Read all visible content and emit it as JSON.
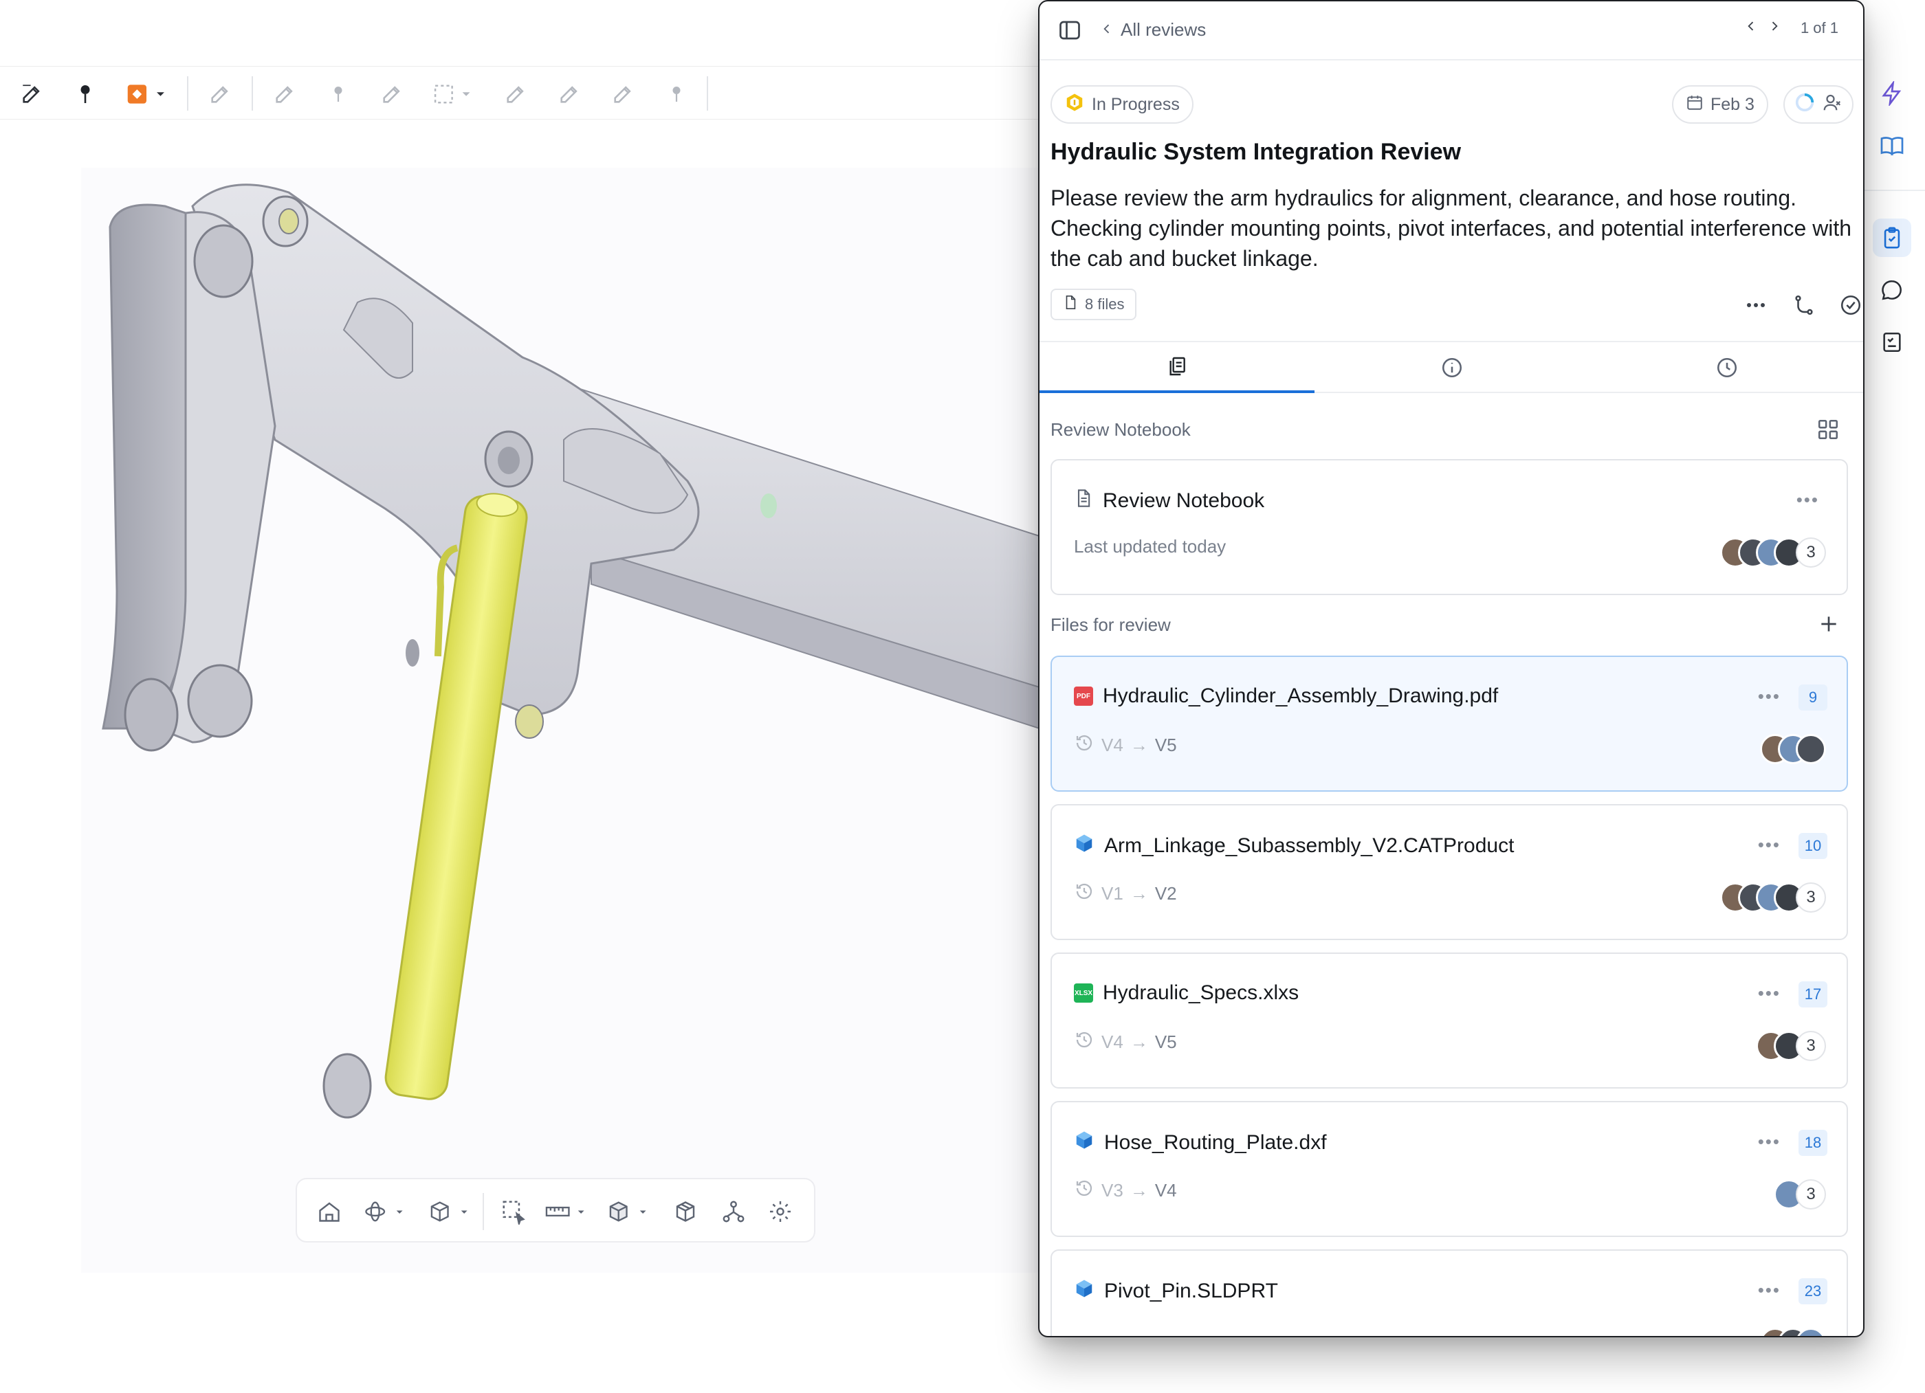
{
  "toolbar": {
    "tools": [
      "pencil-icon",
      "pin-icon",
      "shape-fill-icon",
      "pencil-icon",
      "pencil-icon",
      "pin-icon",
      "pencil-icon",
      "selection-icon",
      "pencil-icon",
      "pencil-icon",
      "pencil-icon",
      "pin-icon"
    ]
  },
  "viewbar": {
    "tools": [
      "home-icon",
      "orbit-icon",
      "cube-icon",
      "box-select-icon",
      "measure-icon",
      "section-cube-icon",
      "explode-icon",
      "tree-icon",
      "settings-icon"
    ]
  },
  "rail": {
    "items": [
      "lightning-icon",
      "book-icon",
      "review-clipboard-icon",
      "comment-icon",
      "checklist-icon"
    ],
    "active": "review-clipboard-icon"
  },
  "panel": {
    "back_label": "All reviews",
    "pager": "1 of 1",
    "status": "In Progress",
    "due_date": "Feb 3",
    "title": "Hydraulic System Integration Review",
    "description": "Please review the arm hydraulics for alignment, clearance, and hose routing. Checking cylinder mounting points, pivot interfaces, and potential interference with the cab and bucket linkage.",
    "files_chip": "8 files",
    "tabs": [
      "files-tab",
      "info-tab",
      "history-tab"
    ],
    "notebook_section": "Review Notebook",
    "notebook": {
      "title": "Review Notebook",
      "updated": "Last updated today",
      "reviewers": "3"
    },
    "files_section": "Files for review",
    "files": [
      {
        "name": "Hydraulic_Cylinder_Assembly_Drawing.pdf",
        "type": "PDF",
        "from": "V4",
        "to": "V5",
        "count": "9",
        "reviewers": ""
      },
      {
        "name": "Arm_Linkage_Subassembly_V2.CATProduct",
        "type": "CAD",
        "from": "V1",
        "to": "V2",
        "count": "10",
        "reviewers": "3"
      },
      {
        "name": "Hydraulic_Specs.xlxs",
        "type": "XLSX",
        "from": "V4",
        "to": "V5",
        "count": "17",
        "reviewers": "3"
      },
      {
        "name": "Hose_Routing_Plate.dxf",
        "type": "CAD",
        "from": "V3",
        "to": "V4",
        "count": "18",
        "reviewers": "3"
      },
      {
        "name": "Pivot_Pin.SLDPRT",
        "type": "CAD",
        "from": "",
        "to": "",
        "count": "23",
        "reviewers": ""
      }
    ]
  },
  "colors": {
    "accent": "#1a6fd9",
    "model_highlight": "#eef07a",
    "status_icon": "#e8b400"
  }
}
